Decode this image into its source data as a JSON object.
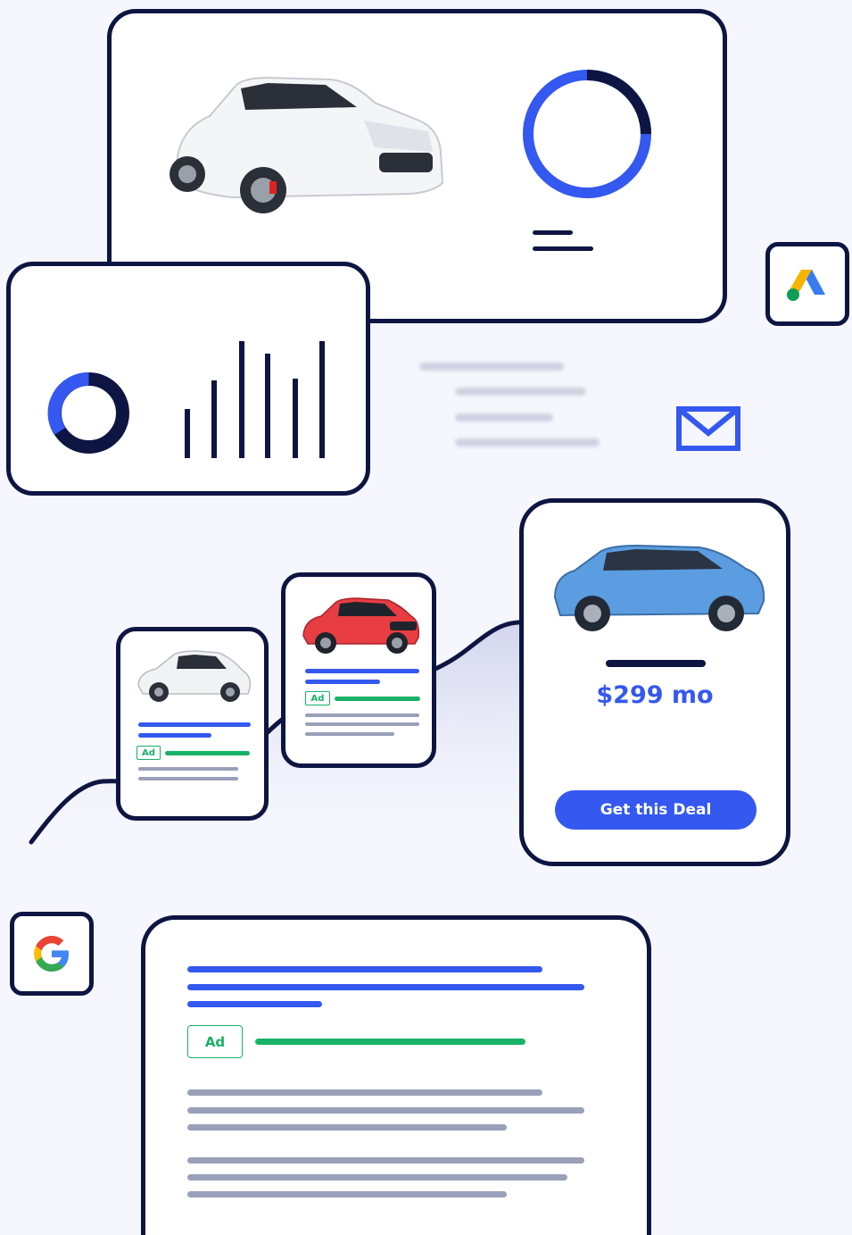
{
  "colors": {
    "navy": "#0d1542",
    "accent_blue": "#3458f0",
    "ad_green": "#17b266",
    "text_gray": "#99a0b8",
    "background": "#f6f7fe"
  },
  "icons": {
    "google_ads": "google-ads-logo",
    "mail": "mail-envelope",
    "google": "google-g-logo"
  },
  "ads": {
    "small_card_badge": "Ad",
    "medium_card_badge": "Ad",
    "search_result_badge": "Ad"
  },
  "deal": {
    "price": "$299 mo",
    "button_label": "Get this Deal"
  }
}
